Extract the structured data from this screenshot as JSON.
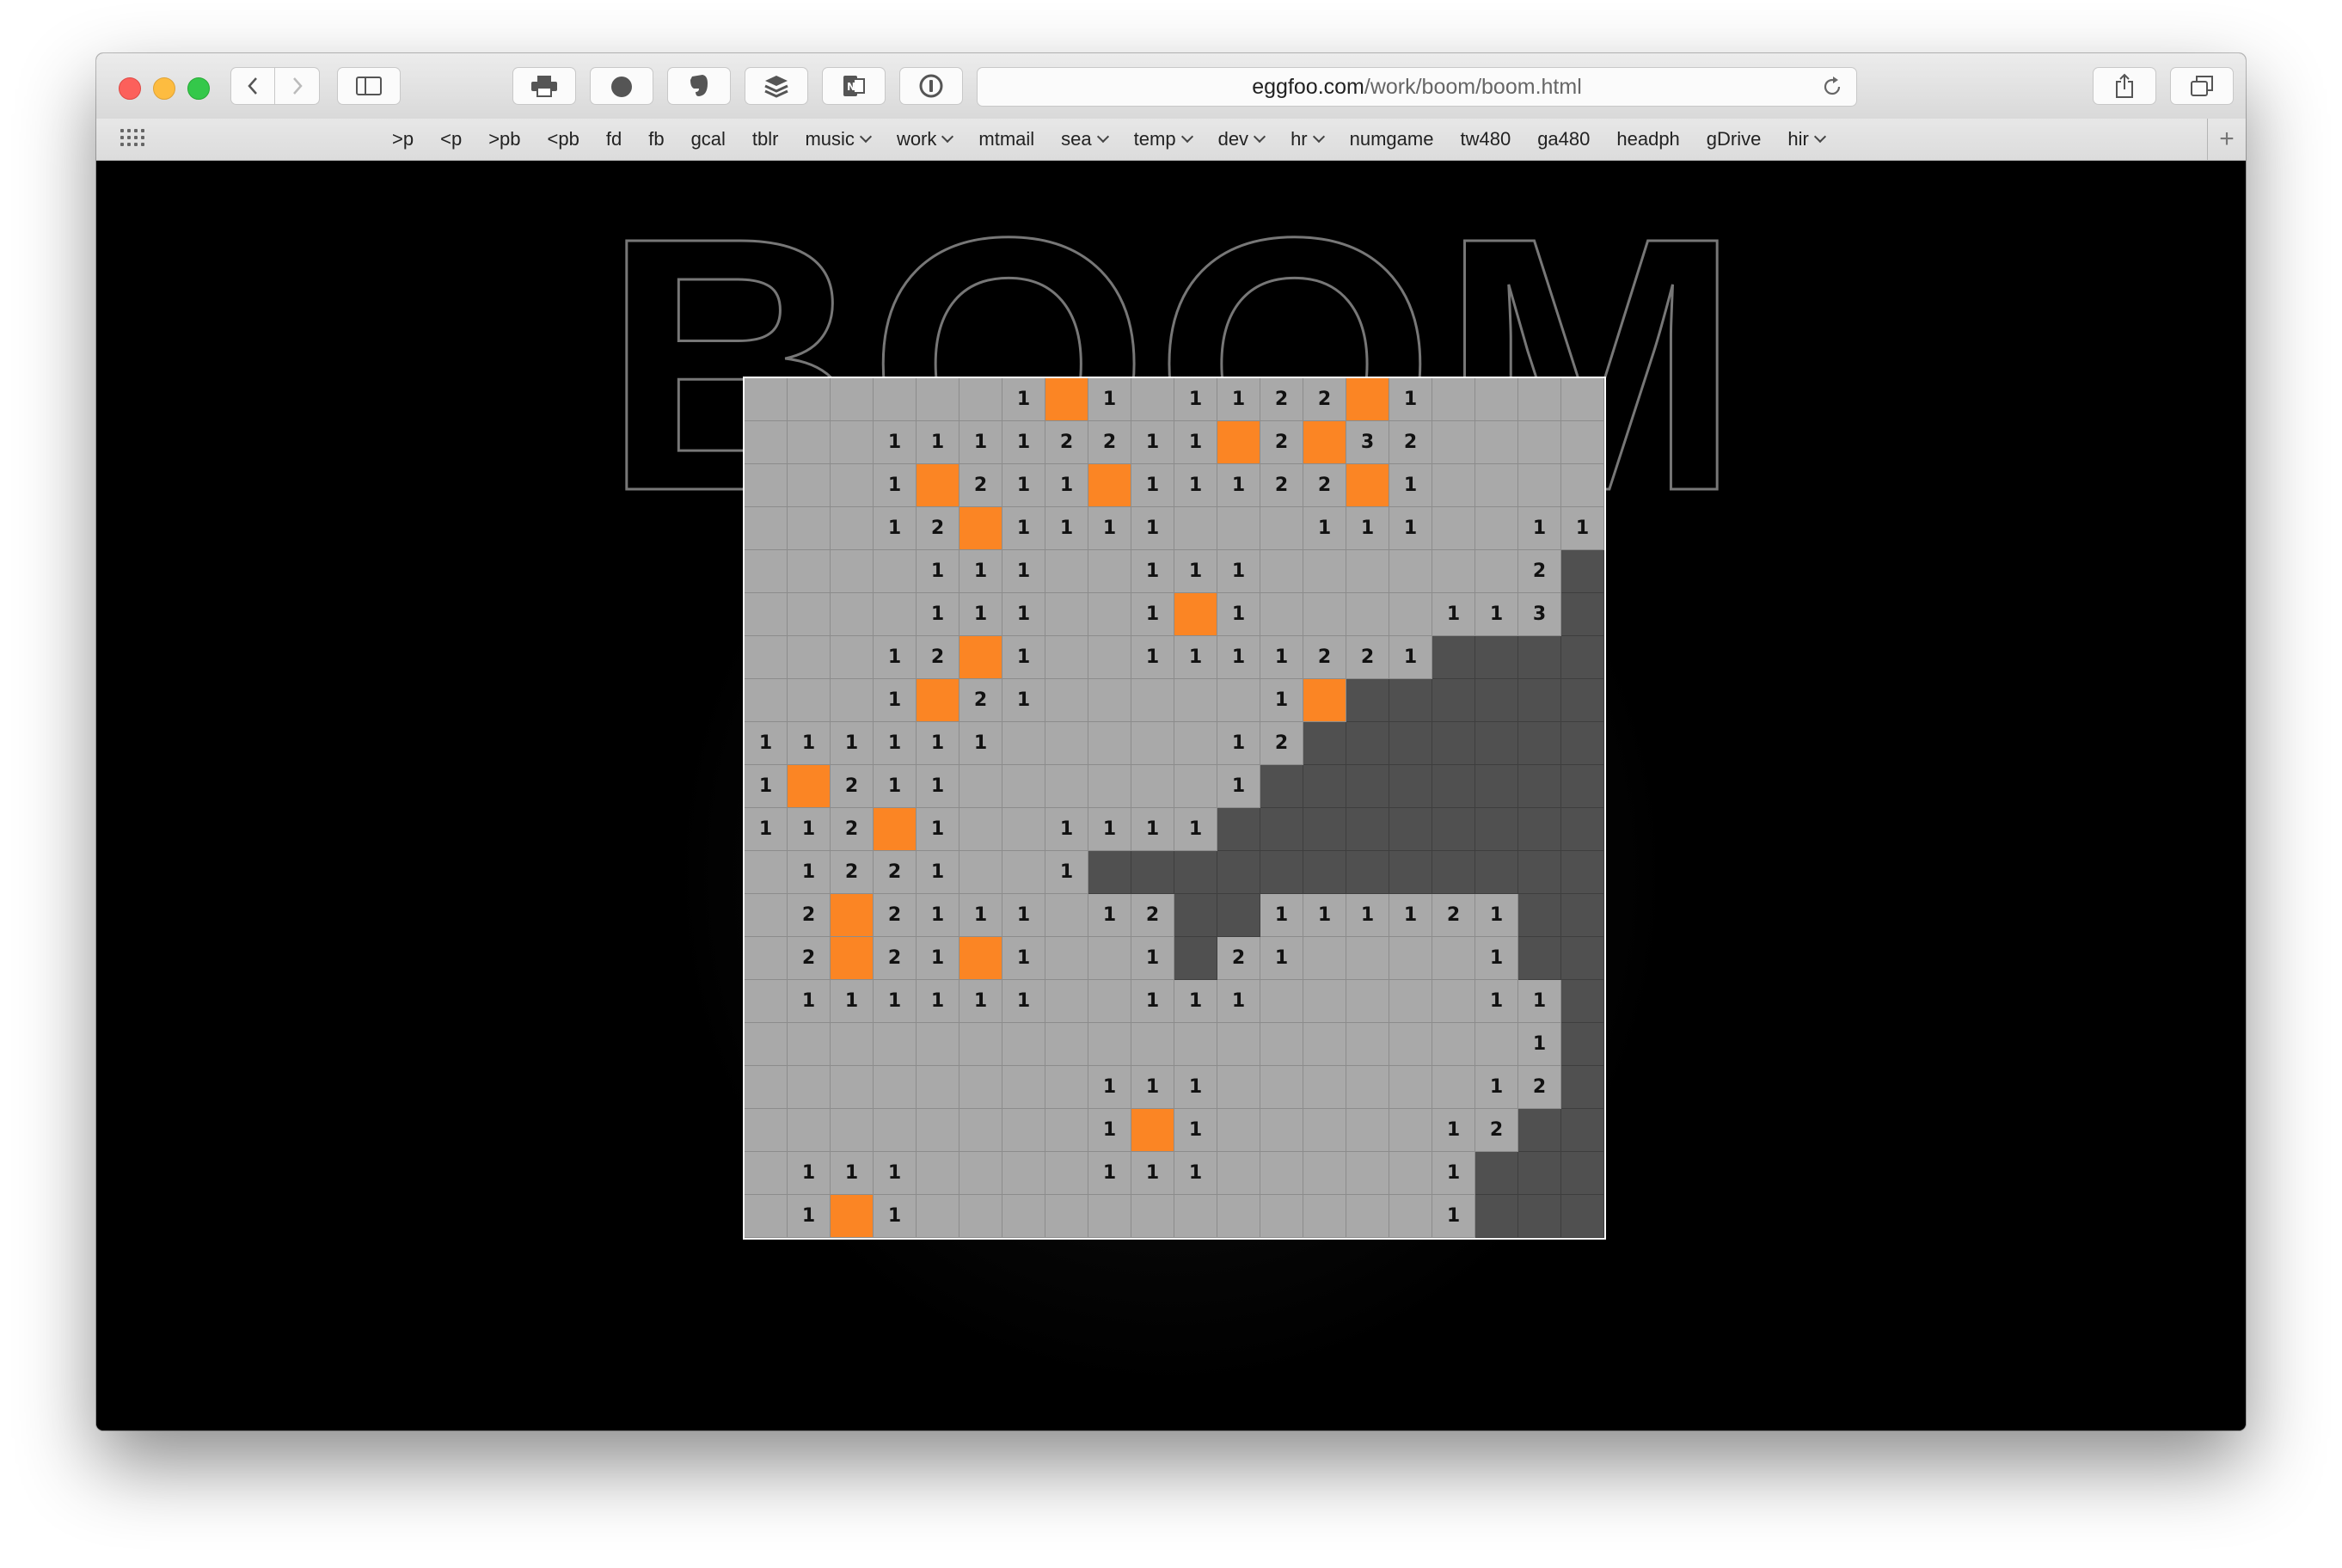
{
  "browser": {
    "url_host": "eggfoo.com",
    "url_path": "/work/boom/boom.html",
    "toolbar_icons": [
      "back-icon",
      "forward-icon",
      "sidebar-icon",
      "print-icon",
      "face-icon",
      "evernote-icon",
      "stack-icon",
      "onenote-icon",
      "1password-icon",
      "share-icon",
      "tabs-icon"
    ]
  },
  "bookmarks": [
    {
      "label": ">p",
      "menu": false
    },
    {
      "label": "<p",
      "menu": false
    },
    {
      "label": ">pb",
      "menu": false
    },
    {
      "label": "<pb",
      "menu": false
    },
    {
      "label": "fd",
      "menu": false
    },
    {
      "label": "fb",
      "menu": false
    },
    {
      "label": "gcal",
      "menu": false
    },
    {
      "label": "tblr",
      "menu": false
    },
    {
      "label": "music",
      "menu": true
    },
    {
      "label": "work",
      "menu": true
    },
    {
      "label": "mtmail",
      "menu": false
    },
    {
      "label": "sea",
      "menu": true
    },
    {
      "label": "temp",
      "menu": true
    },
    {
      "label": "dev",
      "menu": true
    },
    {
      "label": "hr",
      "menu": true
    },
    {
      "label": "numgame",
      "menu": false
    },
    {
      "label": "tw480",
      "menu": false
    },
    {
      "label": "ga480",
      "menu": false
    },
    {
      "label": "headph",
      "menu": false
    },
    {
      "label": "gDrive",
      "menu": false
    },
    {
      "label": "hir",
      "menu": true
    }
  ],
  "game": {
    "title": "BOOM",
    "legend": {
      "blank": ".",
      "mine": "M",
      "hidden": "H"
    },
    "rows": [
      "......1M1.1122M1....",
      "...11112211M2M32....",
      "...1M211M11122M1....",
      "...12M1111...111..11",
      "....111..111......2H",
      "....111..1M1....113H",
      "...12M1..1111221HHHH",
      "...1M21.....1MHHHHHH",
      "111111.....12HHHHHHH",
      "1M211......1HHHHHHHH",
      "112M1..1111HHHHHHHHH",
      ".1221..1HHHHHHHHHHHH",
      ".2M2111.12HH111121HH",
      ".2M21M1..1H21....1HH",
      ".111111..111.....11H",
      "..................1H",
      "........111......12H",
      "........1M1.....12HH",
      ".111....111.....1HHH",
      ".1M1............1HHH"
    ]
  }
}
